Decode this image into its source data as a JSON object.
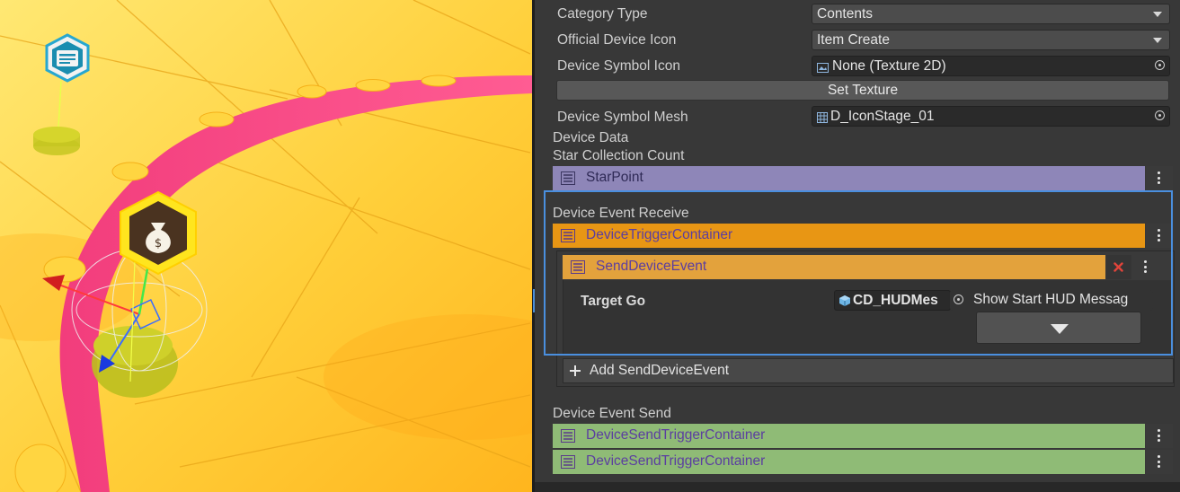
{
  "inspector": {
    "category_type": {
      "label": "Category Type",
      "value": "Contents"
    },
    "official_device_icon": {
      "label": "Official Device Icon",
      "value": "Item Create"
    },
    "device_symbol_icon": {
      "label": "Device Symbol Icon",
      "value": "None (Texture 2D)"
    },
    "set_texture_label": "Set Texture",
    "device_symbol_mesh": {
      "label": "Device Symbol Mesh",
      "value": "D_IconStage_01"
    },
    "device_data_label": "Device Data",
    "star_collection_label": "Star Collection Count",
    "star_point_label": "StarPoint",
    "receive": {
      "label": "Device Event Receive",
      "container_label": "DeviceTriggerContainer",
      "event_label": "SendDeviceEvent",
      "target_go_label": "Target Go",
      "target_go_value": "CD_HUDMes",
      "method_value": "Show Start HUD Messag",
      "add_label": "Add SendDeviceEvent"
    },
    "send": {
      "label": "Device Event Send",
      "containers": [
        "DeviceSendTriggerContainer",
        "DeviceSendTriggerContainer"
      ]
    }
  },
  "colors": {
    "accent_highlight": "#4a8fdf",
    "star_bar": "#8e86b8",
    "trigger_container": "#e89614",
    "send_device_event": "#e3a23c",
    "send_container": "#8fbb76",
    "inspector_bg": "#383838"
  },
  "icons": {
    "scene_device_marker": "menu-card-icon",
    "scene_selected_marker": "money-bag-icon",
    "texture_icon": "texture-icon",
    "mesh_icon": "mesh-grid-icon",
    "list_icon": "list-icon",
    "gameobject_icon": "cube-icon"
  }
}
